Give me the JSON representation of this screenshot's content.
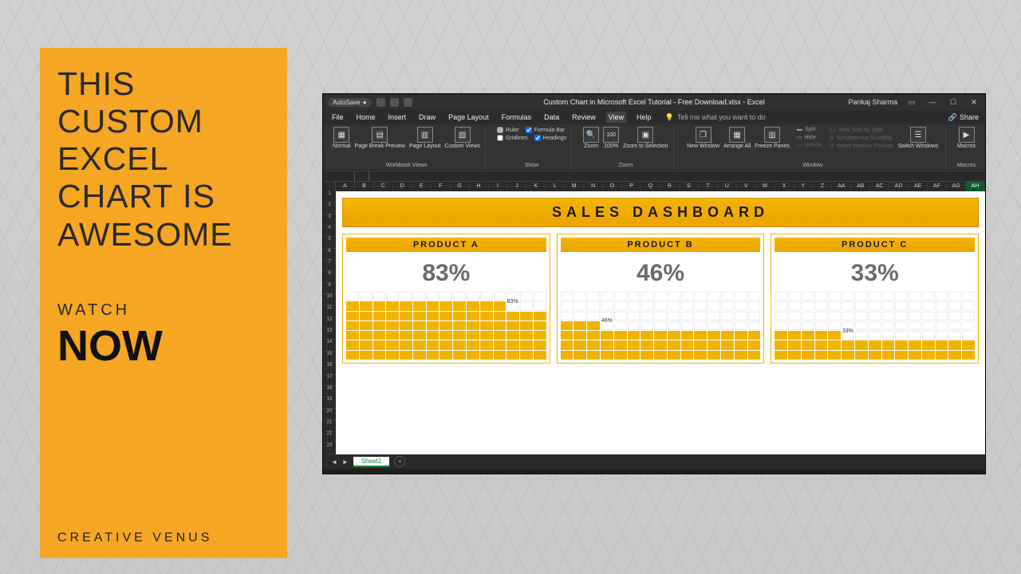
{
  "promo": {
    "headline": "THIS\nCUSTOM\nEXCEL\nCHART IS\nAWESOME",
    "watch": "WATCH",
    "now": "NOW",
    "brand": "CREATIVE VENUS"
  },
  "titlebar": {
    "autosave": "AutoSave",
    "doc_title": "Custom Chart in Microsoft Excel Tutorial - Free Download.xlsx - Excel",
    "user": "Pankaj Sharma"
  },
  "tabs": {
    "items": [
      "File",
      "Home",
      "Insert",
      "Draw",
      "Page Layout",
      "Formulas",
      "Data",
      "Review",
      "View",
      "Help"
    ],
    "active": "View",
    "tell_me": "Tell me what you want to do",
    "share": "Share"
  },
  "ribbon": {
    "workbook_views": {
      "label": "Workbook Views",
      "normal": "Normal",
      "page_break": "Page Break Preview",
      "page_layout": "Page Layout",
      "custom_views": "Custom Views"
    },
    "show": {
      "label": "Show",
      "ruler": "Ruler",
      "formula_bar": "Formula Bar",
      "gridlines": "Gridlines",
      "headings": "Headings"
    },
    "zoom": {
      "label": "Zoom",
      "zoom": "Zoom",
      "hundred": "100%",
      "to_selection": "Zoom to Selection"
    },
    "window": {
      "label": "Window",
      "new_window": "New Window",
      "arrange_all": "Arrange All",
      "freeze": "Freeze Panes",
      "split": "Split",
      "hide": "Hide",
      "unhide": "Unhide",
      "side_by_side": "View Side by Side",
      "sync_scroll": "Synchronous Scrolling",
      "reset_pos": "Reset Window Position",
      "switch": "Switch Windows"
    },
    "macros": {
      "label": "Macros",
      "macros": "Macros"
    }
  },
  "columns": [
    "A",
    "B",
    "C",
    "D",
    "E",
    "F",
    "G",
    "H",
    "I",
    "J",
    "K",
    "L",
    "M",
    "N",
    "O",
    "P",
    "Q",
    "R",
    "S",
    "T",
    "U",
    "V",
    "W",
    "X",
    "Y",
    "Z",
    "AA",
    "AB",
    "AC",
    "AD",
    "AE",
    "AF",
    "AG",
    "AH"
  ],
  "active_col": "AH",
  "rows": 23,
  "dashboard": {
    "title": "SALES  DASHBOARD"
  },
  "chart_data": [
    {
      "type": "bar",
      "title": "PRODUCT A",
      "values": [
        83
      ],
      "display": "83%",
      "ylim": [
        0,
        100
      ]
    },
    {
      "type": "bar",
      "title": "PRODUCT B",
      "values": [
        46
      ],
      "display": "46%",
      "ylim": [
        0,
        100
      ]
    },
    {
      "type": "bar",
      "title": "PRODUCT C",
      "values": [
        33
      ],
      "display": "33%",
      "ylim": [
        0,
        100
      ]
    }
  ],
  "sheet_tabs": {
    "active": "Sheet2"
  }
}
